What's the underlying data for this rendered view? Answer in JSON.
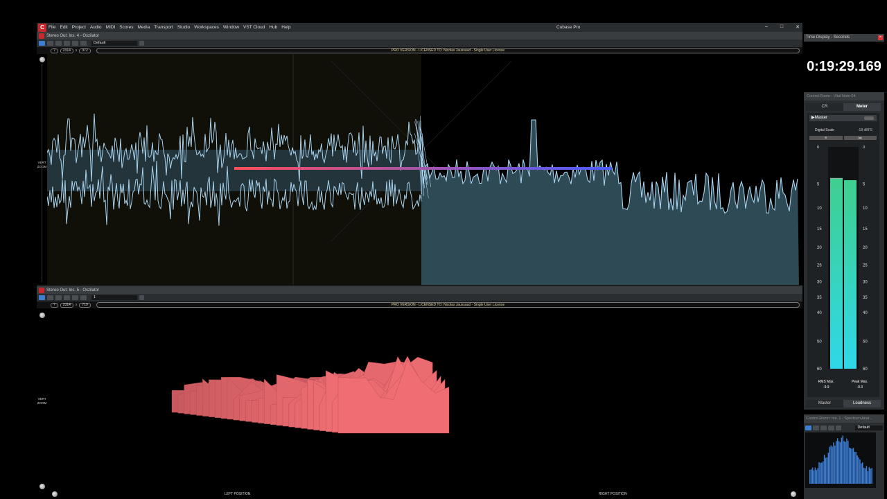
{
  "app": {
    "name": "Cubase Pro",
    "menu": [
      "File",
      "Edit",
      "Project",
      "Audio",
      "MIDI",
      "Scores",
      "Media",
      "Transport",
      "Studio",
      "Workspaces",
      "Window",
      "VST Cloud",
      "Hub",
      "Help"
    ],
    "window_controls": [
      "–",
      "□",
      "✕"
    ]
  },
  "top_plugin": {
    "title": "Stereo Out: Ins. 4 - Oszilator",
    "preset": "Default",
    "num1": "?",
    "width": "2314",
    "times": "x",
    "height": "372",
    "license": "PRO VERSION - LICENSED TO: Nicolas Jaussaud - Single User License",
    "vert_zoom": [
      "VERT",
      "ZOOM"
    ]
  },
  "bottom_plugin": {
    "title": "Stereo Out: Ins. 5 - Oszilator",
    "preset": "1",
    "num1": "?",
    "width": "2314",
    "times": "x",
    "height": "719",
    "license": "PRO VERSION - LICENSED TO: Nicolas Jaussaud - Single User License",
    "vert_zoom": [
      "VERT",
      "ZOOM"
    ],
    "left_position": "LEFT POSITION",
    "right_position": "RIGHT POSITION"
  },
  "time_display": {
    "title": "Time Display - Seconds",
    "value": "0:19:29.169"
  },
  "control_room": {
    "title": "Control Room - Vital Note-04",
    "tabs": [
      "CR",
      "Meter"
    ],
    "active_tab": "Meter",
    "master": "▶Master",
    "digital_scale_label": "Digital Scale",
    "digital_scale_value": "-18 dBFS",
    "scale_ticks": [
      "0",
      "5",
      "10",
      "15",
      "20",
      "25",
      "30",
      "35",
      "40",
      "50",
      "60"
    ],
    "left_level": 0.86,
    "right_level": 0.85,
    "rms_max_label": "RMS Max.",
    "rms_max_value": "-9.9",
    "peak_max_label": "Peak Max.",
    "peak_max_value": "-0.3",
    "bottom_tabs": [
      "Master",
      "Loudness"
    ],
    "active_bottom_tab": "Loudness"
  },
  "spectrum": {
    "title": "Control Room: Ins. 1 - Spectrum Anal...",
    "preset": "Default"
  },
  "colors": {
    "waveform": "#a9d4f0",
    "waveform_fill": "#2e4a55",
    "meter_cyan": "#2fd8e8",
    "meter_green": "#3fcf8f",
    "terrain": "#e36868",
    "red_line": "#ff4d5a",
    "blue_line": "#4a5cff"
  }
}
